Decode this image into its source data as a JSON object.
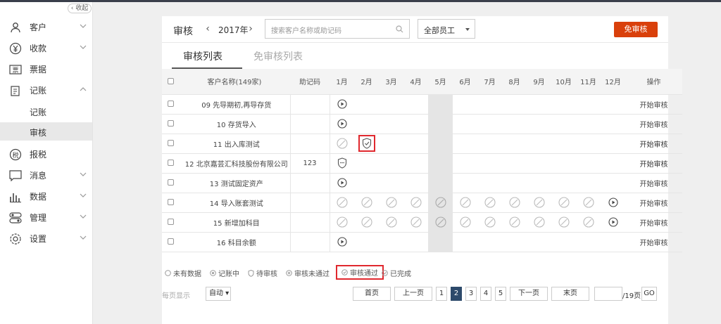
{
  "sidebar": {
    "collapse_label": "收起",
    "items": [
      {
        "label": "客户",
        "icon": "user-icon"
      },
      {
        "label": "收款",
        "icon": "yuan-icon"
      },
      {
        "label": "票据",
        "icon": "receipt-icon"
      },
      {
        "label": "记账",
        "icon": "ledger-icon"
      },
      {
        "label": "报税",
        "icon": "tax-icon"
      },
      {
        "label": "消息",
        "icon": "message-icon"
      },
      {
        "label": "数据",
        "icon": "chart-icon"
      },
      {
        "label": "管理",
        "icon": "toggle-icon"
      },
      {
        "label": "设置",
        "icon": "gear-icon"
      }
    ],
    "sub_items": [
      "记账",
      "审核"
    ],
    "active_sub": "审核"
  },
  "toolbar": {
    "title": "审核",
    "year": "2017年",
    "search_placeholder": "搜索客户名称或助记码",
    "employee_select": "全部员工",
    "exempt_button": "免审核"
  },
  "tabs": [
    "审核列表",
    "免审核列表"
  ],
  "table": {
    "headers": [
      "客户名称(149家)",
      "助记码",
      "1月",
      "2月",
      "3月",
      "4月",
      "5月",
      "6月",
      "7月",
      "8月",
      "9月",
      "10月",
      "11月",
      "12月",
      "操作"
    ],
    "rows": [
      {
        "name": "09 先导期初,再导存货",
        "code": "",
        "action": "开始审核"
      },
      {
        "name": "10 存货导入",
        "code": "",
        "action": "开始审核"
      },
      {
        "name": "11 出入库测试",
        "code": "",
        "action": "开始审核"
      },
      {
        "name": "12 北京嘉芸汇科技股份有限公司",
        "code": "123",
        "action": "开始审核"
      },
      {
        "name": "13 测试固定资产",
        "code": "",
        "action": "开始审核"
      },
      {
        "name": "14 导入账套测试",
        "code": "",
        "action": "开始审核"
      },
      {
        "name": "15 新增加科目",
        "code": "",
        "action": "开始审核"
      },
      {
        "name": "16 科目余额",
        "code": "",
        "action": "开始审核"
      }
    ]
  },
  "legend": [
    "未有数据",
    "记账中",
    "待审核",
    "审核未通过",
    "审核通过",
    "已完成"
  ],
  "pager": {
    "per_page_label": "每页显示",
    "per_page_value": "自动",
    "first": "首页",
    "prev": "上一页",
    "pages": [
      "1",
      "2",
      "3",
      "4",
      "5"
    ],
    "next": "下一页",
    "last": "末页",
    "total": "/19页",
    "go": "GO"
  },
  "colors": {
    "accent": "#d9400b",
    "highlight": "#e0282e",
    "current_page": "#2d4a6b"
  }
}
